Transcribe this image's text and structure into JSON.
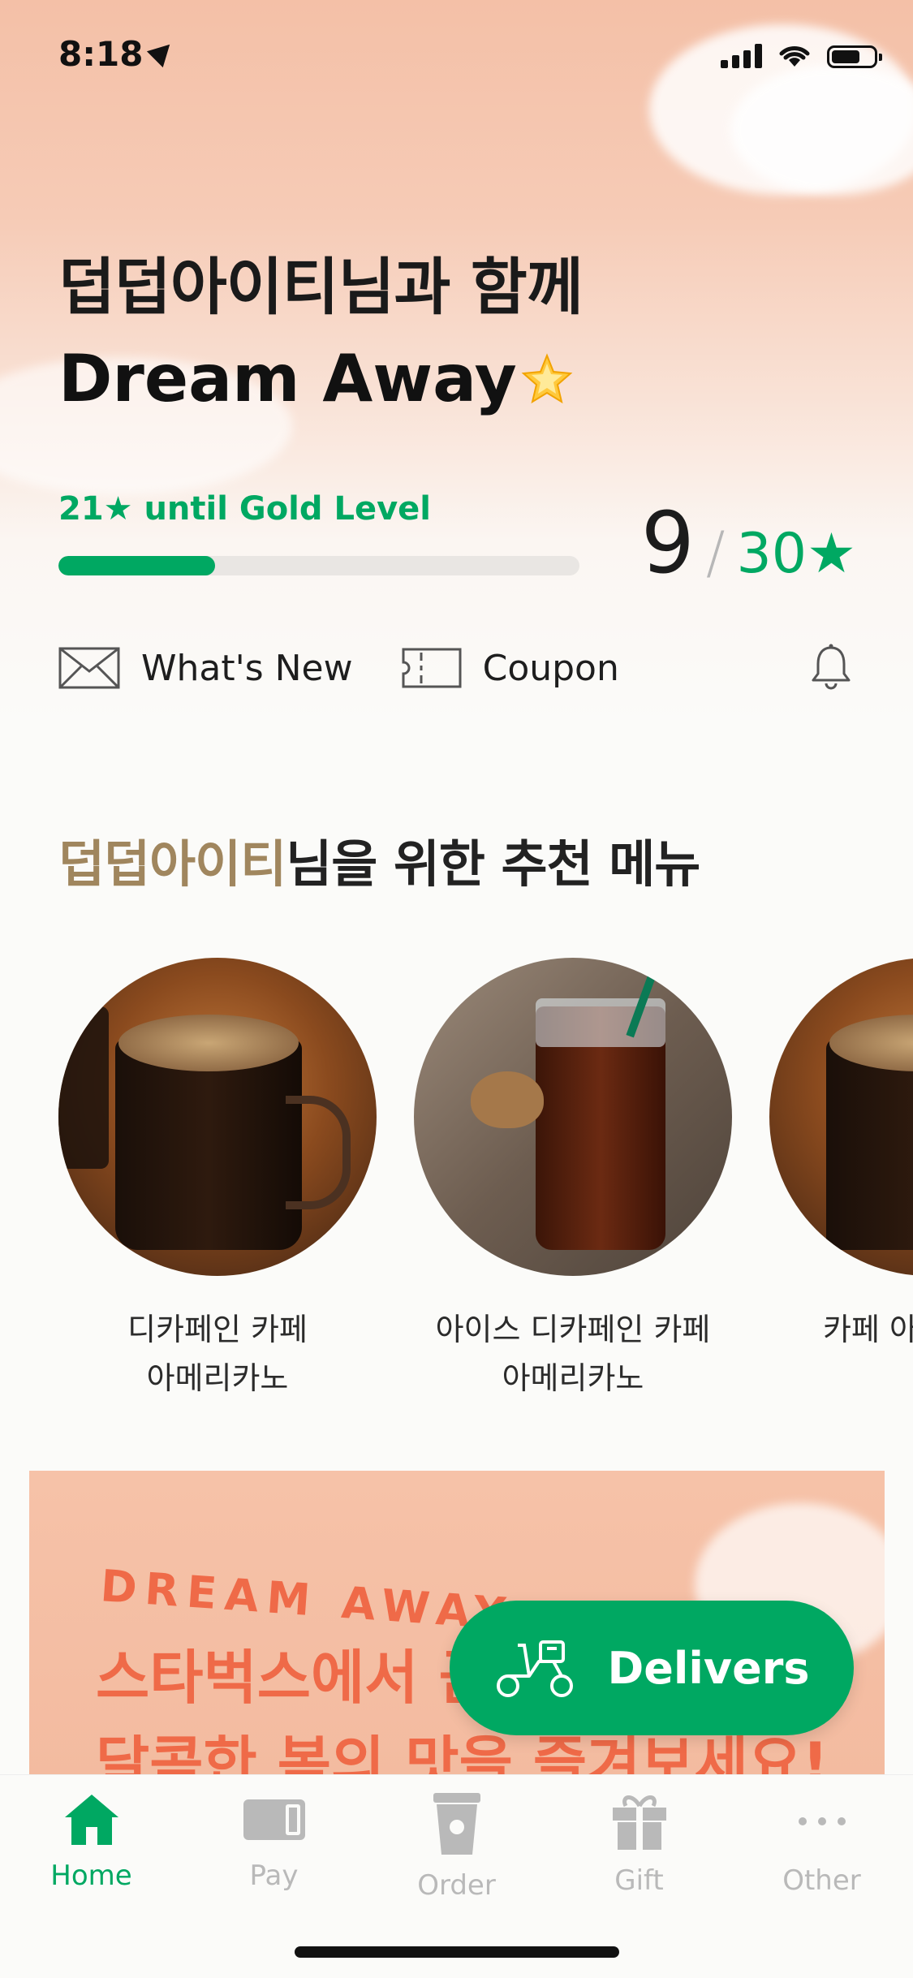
{
  "status_bar": {
    "time": "8:18"
  },
  "hero": {
    "greeting_line1": "덥덥아이티님과 함께",
    "greeting_line2": "Dream Away",
    "stars_until_text": "21★ until Gold Level",
    "progress_fraction": 0.3,
    "current_stars": "9",
    "separator": "/",
    "target_stars": "30★"
  },
  "quick_links": {
    "whats_new": "What's New",
    "coupon": "Coupon"
  },
  "recommend": {
    "name": "덥덥아이티",
    "title_suffix": "님을 위한 추천 메뉴",
    "items": [
      {
        "line1": "디카페인 카페",
        "line2": "아메리카노"
      },
      {
        "line1": "아이스 디카페인 카페",
        "line2": "아메리카노"
      },
      {
        "line1": "카페 아",
        "line2": ""
      }
    ]
  },
  "banner": {
    "kicker": "DREAM AWAY",
    "line1": "스타벅스에서 곧",
    "line2": "달콤한 봄의 맛을 즐겨보세요!"
  },
  "fab": {
    "label": "Delivers"
  },
  "tabs": [
    {
      "label": "Home",
      "icon": "home-icon",
      "active": true
    },
    {
      "label": "Pay",
      "icon": "card-icon"
    },
    {
      "label": "Order",
      "icon": "cup-icon"
    },
    {
      "label": "Gift",
      "icon": "gift-icon"
    },
    {
      "label": "Other",
      "icon": "more-icon"
    }
  ],
  "colors": {
    "accent": "#00a862",
    "hero_peach": "#f4c0a7",
    "name_gold": "#a0865e",
    "banner_text": "#ef6a48"
  }
}
